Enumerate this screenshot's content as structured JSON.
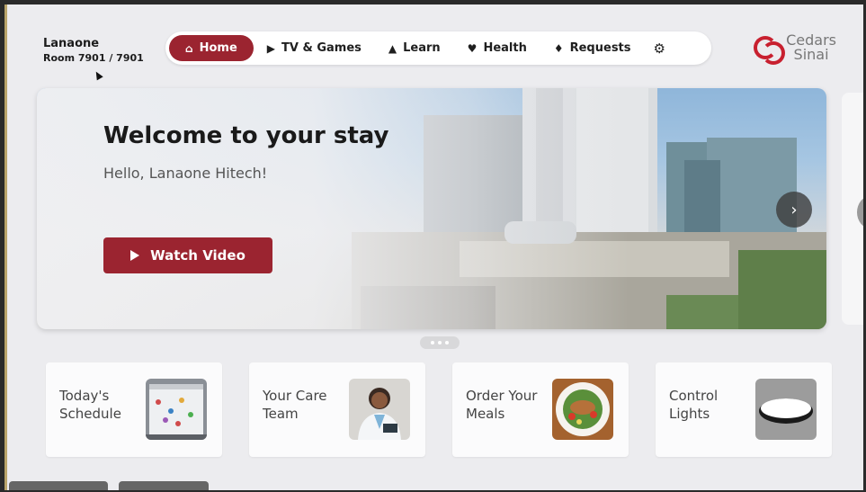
{
  "patient": {
    "name": "Lanaone",
    "room": "Room 7901 / 7901"
  },
  "nav": {
    "tabs": [
      {
        "label": "Home",
        "icon": "home-icon"
      },
      {
        "label": "TV & Games",
        "icon": "play-circle-icon"
      },
      {
        "label": "Learn",
        "icon": "graduation-cap-icon"
      },
      {
        "label": "Health",
        "icon": "heart-pulse-icon"
      },
      {
        "label": "Requests",
        "icon": "bell-icon"
      }
    ],
    "settings_icon": "gear-icon",
    "active": "Home"
  },
  "logo": {
    "line1": "Cedars",
    "line2": "Sinai"
  },
  "hero": {
    "title": "Welcome to your stay",
    "greeting": "Hello, Lanaone Hitech!",
    "button": "Watch Video"
  },
  "cards": [
    {
      "label": "Today's Schedule"
    },
    {
      "label": "Your Care Team"
    },
    {
      "label": "Order Your Meals"
    },
    {
      "label": "Control Lights"
    }
  ],
  "colors": {
    "accent": "#9b2430",
    "logo": "#c8202f",
    "background": "#ececef"
  }
}
